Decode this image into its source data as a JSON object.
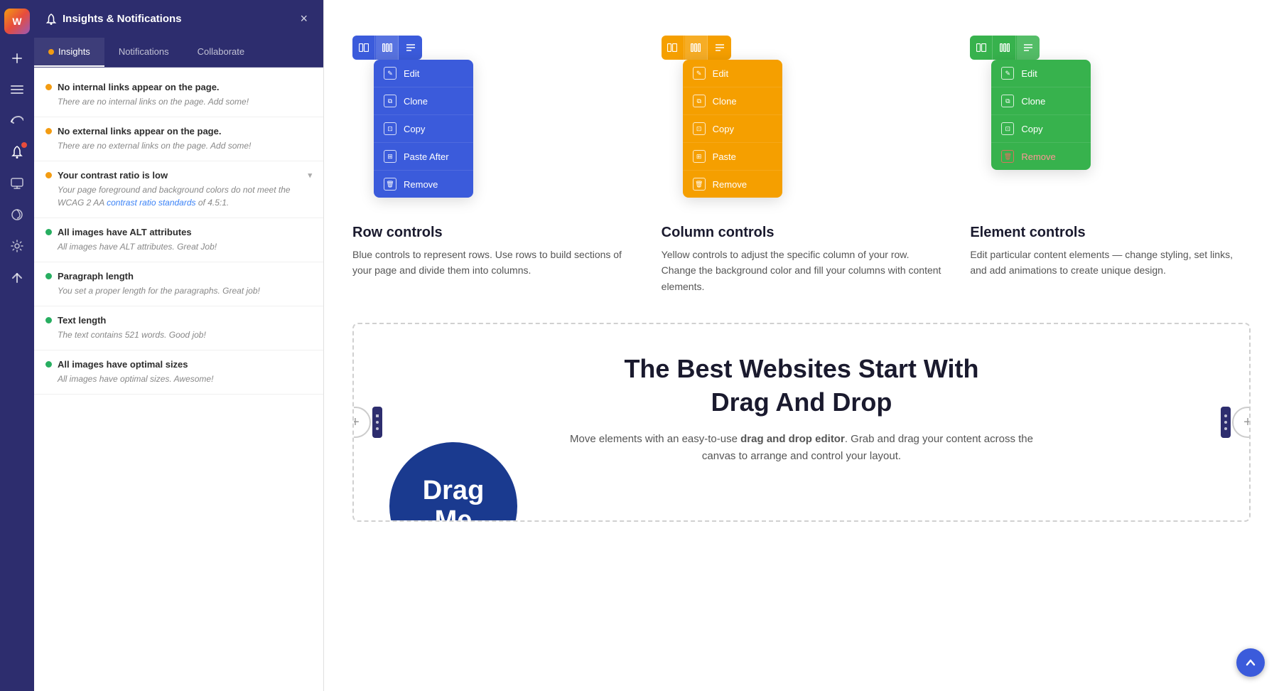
{
  "app": {
    "logo_text": "W",
    "panel_title": "Insights & Notifications"
  },
  "sidebar": {
    "icons": [
      {
        "name": "add-icon",
        "symbol": "+",
        "active": false
      },
      {
        "name": "layers-icon",
        "symbol": "≡",
        "active": false
      },
      {
        "name": "undo-icon",
        "symbol": "↺",
        "active": false
      },
      {
        "name": "notifications-icon",
        "symbol": "🔔",
        "active": true,
        "badge": true
      },
      {
        "name": "monitor-icon",
        "symbol": "⬜",
        "active": false
      },
      {
        "name": "palette-icon",
        "symbol": "🎨",
        "active": false
      },
      {
        "name": "settings-icon",
        "symbol": "⚙",
        "active": false
      },
      {
        "name": "checkmark-icon",
        "symbol": "✓",
        "active": false
      }
    ]
  },
  "panel": {
    "title": "Insights & Notifications",
    "close_label": "×",
    "tabs": [
      {
        "label": "Insights",
        "active": true,
        "dot": true
      },
      {
        "label": "Notifications",
        "active": false
      },
      {
        "label": "Collaborate",
        "active": false
      }
    ],
    "insights": [
      {
        "type": "orange",
        "title": "No internal links appear on the page.",
        "desc": "There are no internal links on the page. Add some!"
      },
      {
        "type": "orange",
        "title": "No external links appear on the page.",
        "desc": "There are no external links on the page. Add some!"
      },
      {
        "type": "orange",
        "title": "Your contrast ratio is low",
        "desc_parts": [
          "Your page foreground and background colors do not meet the WCAG 2 AA ",
          "contrast ratio standards",
          " of 4.5:1."
        ],
        "has_link": true
      },
      {
        "type": "green",
        "title": "All images have ALT attributes",
        "desc": "All images have ALT attributes. Great Job!"
      },
      {
        "type": "green",
        "title": "Paragraph length",
        "desc": "You set a proper length for the paragraphs. Great job!"
      },
      {
        "type": "green",
        "title": "Text length",
        "desc": "The text contains 521 words. Good job!"
      },
      {
        "type": "green",
        "title": "All images have optimal sizes",
        "desc": "All images have optimal sizes. Awesome!"
      }
    ]
  },
  "controls": {
    "row": {
      "label": "Row controls",
      "desc": "Blue controls to represent rows. Use rows to build sections of your page and divide them into columns.",
      "color": "blue",
      "menu_items": [
        {
          "label": "Edit",
          "icon": "pencil"
        },
        {
          "label": "Clone",
          "icon": "clone"
        },
        {
          "label": "Copy",
          "icon": "copy"
        },
        {
          "label": "Paste After",
          "icon": "paste"
        },
        {
          "label": "Remove",
          "icon": "trash",
          "danger": false
        }
      ]
    },
    "column": {
      "label": "Column controls",
      "desc": "Yellow controls to adjust the specific column of your row. Change the background color and fill your columns with content elements.",
      "color": "yellow",
      "menu_items": [
        {
          "label": "Edit",
          "icon": "pencil"
        },
        {
          "label": "Clone",
          "icon": "clone"
        },
        {
          "label": "Copy",
          "icon": "copy"
        },
        {
          "label": "Paste",
          "icon": "paste"
        },
        {
          "label": "Remove",
          "icon": "trash",
          "danger": false
        }
      ]
    },
    "element": {
      "label": "Element controls",
      "desc": "Edit particular content elements — change styling, set links, and add animations to create unique design.",
      "color": "green",
      "menu_items": [
        {
          "label": "Edit",
          "icon": "pencil"
        },
        {
          "label": "Clone",
          "icon": "clone"
        },
        {
          "label": "Copy",
          "icon": "copy"
        },
        {
          "label": "Remove",
          "icon": "trash",
          "danger": true
        }
      ]
    }
  },
  "dnd_section": {
    "heading_line1": "The Best Websites Start With",
    "heading_line2": "Drag And Drop",
    "desc_prefix": "Move elements with an easy-to-use ",
    "desc_bold": "drag and drop editor",
    "desc_suffix": ". Grab and drag your content across the canvas to arrange and control your layout.",
    "drag_text_line1": "Drag",
    "drag_text_line2": "Me"
  },
  "icons_map": {
    "pencil": "✎",
    "clone": "⧉",
    "copy": "⧉",
    "paste": "📋",
    "trash": "🗑",
    "bell": "🔔",
    "plus": "+"
  }
}
